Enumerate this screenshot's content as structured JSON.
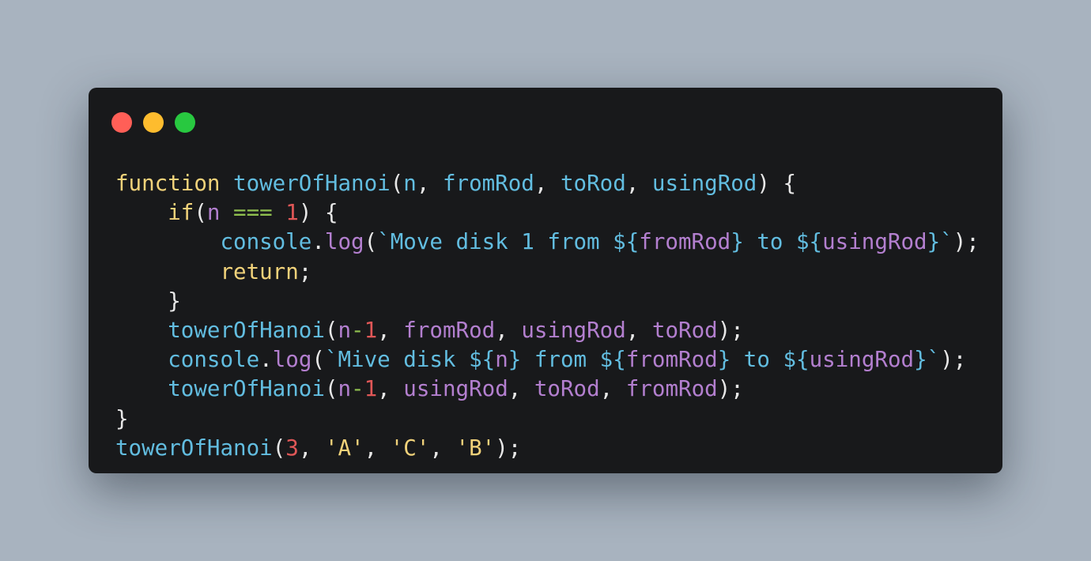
{
  "window": {
    "buttons": [
      {
        "name": "close",
        "color": "#ff5f57"
      },
      {
        "name": "minimize",
        "color": "#febc2e"
      },
      {
        "name": "maximize",
        "color": "#28c840"
      }
    ]
  },
  "code": {
    "language": "javascript",
    "lines": [
      [
        {
          "t": "function",
          "k": "kw"
        },
        {
          "t": " ",
          "k": "pn"
        },
        {
          "t": "towerOfHanoi",
          "k": "fn"
        },
        {
          "t": "(",
          "k": "pn"
        },
        {
          "t": "n",
          "k": "fn"
        },
        {
          "t": ", ",
          "k": "pn"
        },
        {
          "t": "fromRod",
          "k": "fn"
        },
        {
          "t": ", ",
          "k": "pn"
        },
        {
          "t": "toRod",
          "k": "fn"
        },
        {
          "t": ", ",
          "k": "pn"
        },
        {
          "t": "usingRod",
          "k": "fn"
        },
        {
          "t": ") {",
          "k": "pn"
        }
      ],
      [
        {
          "t": "    ",
          "k": "pn"
        },
        {
          "t": "if",
          "k": "kw"
        },
        {
          "t": "(",
          "k": "pn"
        },
        {
          "t": "n",
          "k": "pm"
        },
        {
          "t": " ",
          "k": "pn"
        },
        {
          "t": "===",
          "k": "op"
        },
        {
          "t": " ",
          "k": "pn"
        },
        {
          "t": "1",
          "k": "nm"
        },
        {
          "t": ") {",
          "k": "pn"
        }
      ],
      [
        {
          "t": "        ",
          "k": "pn"
        },
        {
          "t": "console",
          "k": "fn"
        },
        {
          "t": ".",
          "k": "pn"
        },
        {
          "t": "log",
          "k": "pm"
        },
        {
          "t": "(",
          "k": "pn"
        },
        {
          "t": "`Move disk 1 from ",
          "k": "st"
        },
        {
          "t": "${",
          "k": "st"
        },
        {
          "t": "fromRod",
          "k": "ip"
        },
        {
          "t": "}",
          "k": "st"
        },
        {
          "t": " to ",
          "k": "st"
        },
        {
          "t": "${",
          "k": "st"
        },
        {
          "t": "usingRod",
          "k": "ip"
        },
        {
          "t": "}",
          "k": "st"
        },
        {
          "t": "`",
          "k": "st"
        },
        {
          "t": ");",
          "k": "pn"
        }
      ],
      [
        {
          "t": "        ",
          "k": "pn"
        },
        {
          "t": "return",
          "k": "kw"
        },
        {
          "t": ";",
          "k": "pn"
        }
      ],
      [
        {
          "t": "    }",
          "k": "pn"
        }
      ],
      [
        {
          "t": "    ",
          "k": "pn"
        },
        {
          "t": "towerOfHanoi",
          "k": "fn"
        },
        {
          "t": "(",
          "k": "pn"
        },
        {
          "t": "n",
          "k": "pm"
        },
        {
          "t": "-",
          "k": "op"
        },
        {
          "t": "1",
          "k": "nm"
        },
        {
          "t": ", ",
          "k": "pn"
        },
        {
          "t": "fromRod",
          "k": "pm"
        },
        {
          "t": ", ",
          "k": "pn"
        },
        {
          "t": "usingRod",
          "k": "pm"
        },
        {
          "t": ", ",
          "k": "pn"
        },
        {
          "t": "toRod",
          "k": "pm"
        },
        {
          "t": ");",
          "k": "pn"
        }
      ],
      [
        {
          "t": "    ",
          "k": "pn"
        },
        {
          "t": "console",
          "k": "fn"
        },
        {
          "t": ".",
          "k": "pn"
        },
        {
          "t": "log",
          "k": "pm"
        },
        {
          "t": "(",
          "k": "pn"
        },
        {
          "t": "`Mive disk ",
          "k": "st"
        },
        {
          "t": "${",
          "k": "st"
        },
        {
          "t": "n",
          "k": "ip"
        },
        {
          "t": "}",
          "k": "st"
        },
        {
          "t": " from ",
          "k": "st"
        },
        {
          "t": "${",
          "k": "st"
        },
        {
          "t": "fromRod",
          "k": "ip"
        },
        {
          "t": "}",
          "k": "st"
        },
        {
          "t": " to ",
          "k": "st"
        },
        {
          "t": "${",
          "k": "st"
        },
        {
          "t": "usingRod",
          "k": "ip"
        },
        {
          "t": "}",
          "k": "st"
        },
        {
          "t": "`",
          "k": "st"
        },
        {
          "t": ");",
          "k": "pn"
        }
      ],
      [
        {
          "t": "    ",
          "k": "pn"
        },
        {
          "t": "towerOfHanoi",
          "k": "fn"
        },
        {
          "t": "(",
          "k": "pn"
        },
        {
          "t": "n",
          "k": "pm"
        },
        {
          "t": "-",
          "k": "op"
        },
        {
          "t": "1",
          "k": "nm"
        },
        {
          "t": ", ",
          "k": "pn"
        },
        {
          "t": "usingRod",
          "k": "pm"
        },
        {
          "t": ", ",
          "k": "pn"
        },
        {
          "t": "toRod",
          "k": "pm"
        },
        {
          "t": ", ",
          "k": "pn"
        },
        {
          "t": "fromRod",
          "k": "pm"
        },
        {
          "t": ");",
          "k": "pn"
        }
      ],
      [
        {
          "t": "}",
          "k": "pn"
        }
      ],
      [
        {
          "t": "towerOfHanoi",
          "k": "fn"
        },
        {
          "t": "(",
          "k": "pn"
        },
        {
          "t": "3",
          "k": "nm"
        },
        {
          "t": ", ",
          "k": "pn"
        },
        {
          "t": "'A'",
          "k": "kw"
        },
        {
          "t": ", ",
          "k": "pn"
        },
        {
          "t": "'C'",
          "k": "kw"
        },
        {
          "t": ", ",
          "k": "pn"
        },
        {
          "t": "'B'",
          "k": "kw"
        },
        {
          "t": ");",
          "k": "pn"
        }
      ]
    ]
  }
}
